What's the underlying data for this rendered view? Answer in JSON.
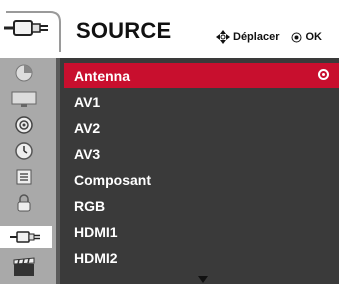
{
  "header": {
    "title": "SOURCE",
    "hint_move": "Déplacer",
    "hint_ok": "OK"
  },
  "sidebar": {
    "items": [
      {
        "name": "picture-icon"
      },
      {
        "name": "screen-icon"
      },
      {
        "name": "audio-icon"
      },
      {
        "name": "time-icon"
      },
      {
        "name": "option-icon"
      },
      {
        "name": "lock-icon"
      },
      {
        "name": "input-icon",
        "active": true
      },
      {
        "name": "movie-icon"
      }
    ]
  },
  "sources": {
    "items": [
      {
        "label": "Antenna",
        "selected": true
      },
      {
        "label": "AV1"
      },
      {
        "label": "AV2"
      },
      {
        "label": "AV3"
      },
      {
        "label": "Composant"
      },
      {
        "label": "RGB"
      },
      {
        "label": "HDMI1"
      },
      {
        "label": "HDMI2"
      }
    ]
  },
  "colors": {
    "accent": "#c80f2e",
    "panel": "#3a3a3a",
    "sidebar": "#a9a9a9"
  }
}
